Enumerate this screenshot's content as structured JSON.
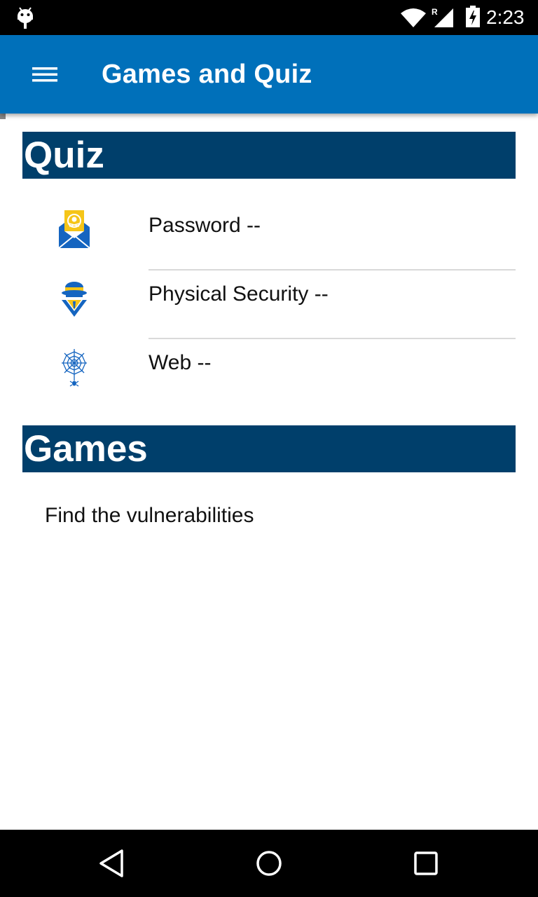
{
  "status_bar": {
    "time": "2:23",
    "network_indicator": "R",
    "icons": [
      "android-icon",
      "wifi-icon",
      "signal-icon",
      "battery-charging-icon"
    ]
  },
  "app_bar": {
    "title": "Games and Quiz",
    "menu_icon": "hamburger-menu-icon"
  },
  "quiz": {
    "header": "Quiz",
    "items": [
      {
        "label": "Password --",
        "icon": "envelope-skull-icon"
      },
      {
        "label": "Physical Security --",
        "icon": "spy-agent-icon"
      },
      {
        "label": "Web --",
        "icon": "spider-web-icon"
      }
    ]
  },
  "games": {
    "header": "Games",
    "items": [
      {
        "label": "Find the vulnerabilities"
      }
    ]
  },
  "nav_bar": {
    "buttons": [
      "back-icon",
      "home-icon",
      "recents-icon"
    ]
  },
  "colors": {
    "app_bar": "#0070ba",
    "section_header": "#003f6b",
    "icon_blue": "#1565c0",
    "icon_yellow": "#f5c518"
  }
}
